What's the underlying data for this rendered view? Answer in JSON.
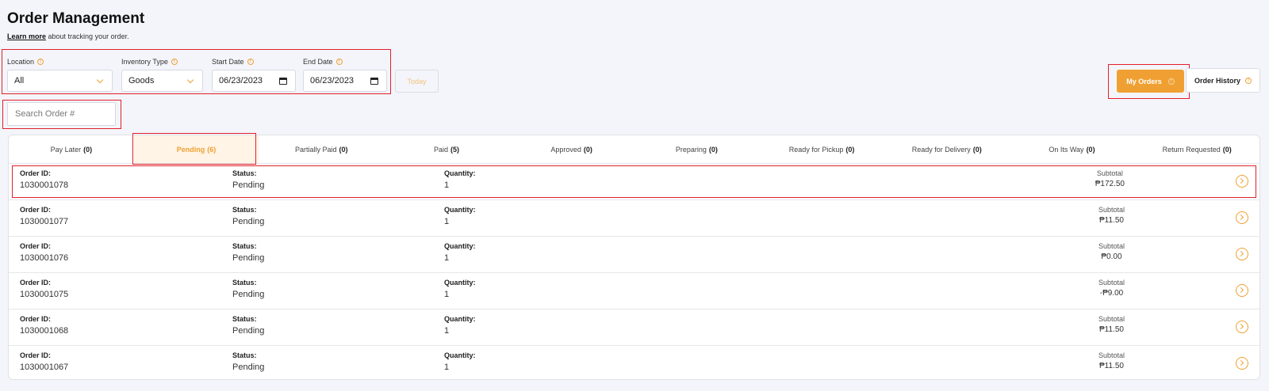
{
  "header": {
    "title": "Order Management",
    "learn_more": "Learn more",
    "learn_suffix": " about tracking your order."
  },
  "filters": {
    "location_label": "Location",
    "location_value": "All",
    "inventory_label": "Inventory Type",
    "inventory_value": "Goods",
    "start_label": "Start Date",
    "start_value": "06/23/2023",
    "end_label": "End Date",
    "end_value": "06/23/2023",
    "today_label": "Today",
    "search_placeholder": "Search Order #"
  },
  "view_toggle": {
    "my_orders": "My Orders",
    "order_history": "Order History"
  },
  "tabs": [
    {
      "label": "Pay Later",
      "count": "(0)"
    },
    {
      "label": "Pending",
      "count": "(6)",
      "active": true
    },
    {
      "label": "Partially Paid",
      "count": "(0)"
    },
    {
      "label": "Paid",
      "count": "(5)"
    },
    {
      "label": "Approved",
      "count": "(0)"
    },
    {
      "label": "Preparing",
      "count": "(0)"
    },
    {
      "label": "Ready for Pickup",
      "count": "(0)"
    },
    {
      "label": "Ready for Delivery",
      "count": "(0)"
    },
    {
      "label": "On Its Way",
      "count": "(0)"
    },
    {
      "label": "Return Requested",
      "count": "(0)"
    }
  ],
  "columns": {
    "order_id": "Order ID:",
    "status": "Status:",
    "quantity": "Quantity:",
    "subtotal": "Subtotal"
  },
  "orders": [
    {
      "id": "1030001078",
      "status": "Pending",
      "quantity": "1",
      "subtotal": "₱172.50"
    },
    {
      "id": "1030001077",
      "status": "Pending",
      "quantity": "1",
      "subtotal": "₱11.50"
    },
    {
      "id": "1030001076",
      "status": "Pending",
      "quantity": "1",
      "subtotal": "₱0.00"
    },
    {
      "id": "1030001075",
      "status": "Pending",
      "quantity": "1",
      "subtotal": "-₱9.00"
    },
    {
      "id": "1030001068",
      "status": "Pending",
      "quantity": "1",
      "subtotal": "₱11.50"
    },
    {
      "id": "1030001067",
      "status": "Pending",
      "quantity": "1",
      "subtotal": "₱11.50"
    }
  ],
  "colors": {
    "accent": "#f0a032",
    "highlight": "#e0202a"
  }
}
